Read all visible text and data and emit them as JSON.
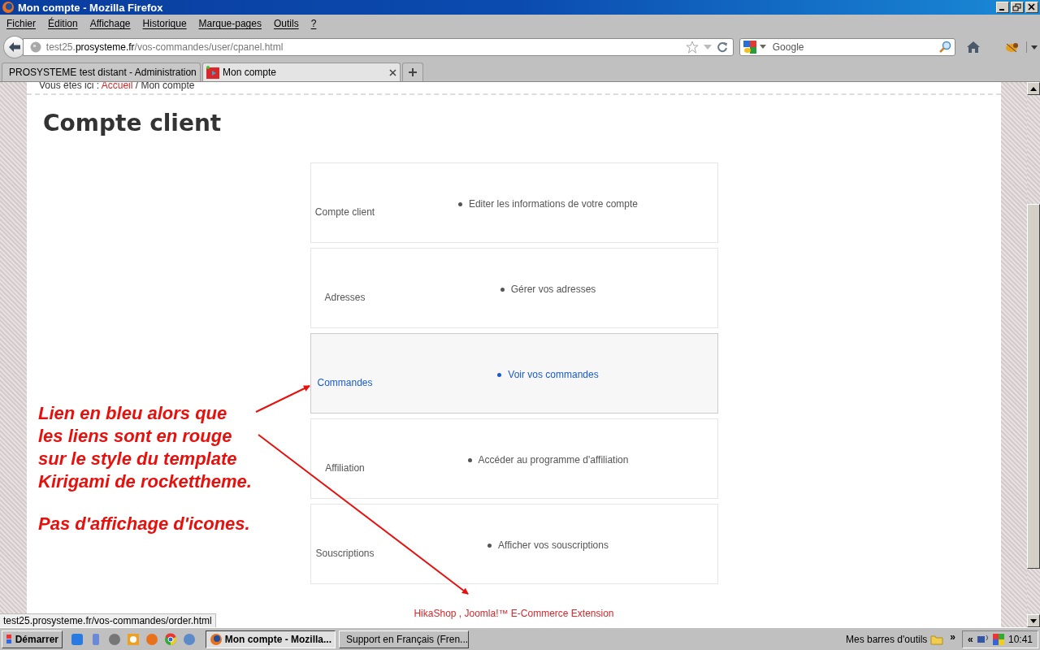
{
  "window": {
    "title": "Mon compte - Mozilla Firefox"
  },
  "menu": [
    "Fichier",
    "Édition",
    "Affichage",
    "Historique",
    "Marque-pages",
    "Outils",
    "?"
  ],
  "address": {
    "subdomain": "test25.",
    "domain": "prosysteme.fr",
    "path": "/vos-commandes/user/cpanel.html"
  },
  "search": {
    "placeholder": "Google"
  },
  "tabs": [
    {
      "label": "PROSYSTEME test distant - Administration",
      "selected": false
    },
    {
      "label": "Mon compte",
      "selected": true
    }
  ],
  "breadcrumb": {
    "prefix": "Vous êtes ici : ",
    "home": "Accueil",
    "separator": " / ",
    "current": "Mon compte"
  },
  "page_title": "Compte client",
  "cards": [
    {
      "label": "Compte client",
      "link": "Editer les informations de votre compte",
      "highlighted": false
    },
    {
      "label": "Adresses",
      "link": "Gérer vos adresses",
      "highlighted": false
    },
    {
      "label": "Commandes",
      "link": "Voir vos commandes",
      "highlighted": true
    },
    {
      "label": "Affiliation",
      "link": "Accéder au programme d'affiliation",
      "highlighted": false
    },
    {
      "label": "Souscriptions",
      "link": "Afficher vos souscriptions",
      "highlighted": false
    }
  ],
  "footer": "HikaShop , Joomla!™ E-Commerce Extension",
  "annotation": [
    "Lien en bleu alors que\nles liens sont en rouge\nsur le style du template\nKirigami de rockettheme.",
    "Pas d'affichage d'icones."
  ],
  "status_url": "test25.prosysteme.fr/vos-commandes/order.html",
  "taskbar": {
    "start": "Démarrer",
    "tasks": [
      {
        "label": "Mon compte - Mozilla...",
        "selected": true
      },
      {
        "label": "Support en Français (Fren...",
        "selected": false
      }
    ],
    "toolbars": "Mes barres d'outils",
    "chevron": "»",
    "tray_chevron": "«",
    "clock": "10:41"
  }
}
